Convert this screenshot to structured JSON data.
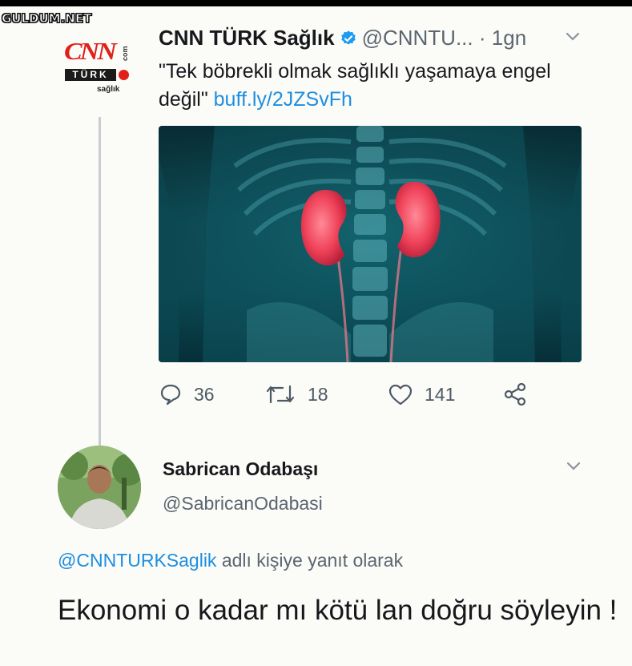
{
  "watermark": "GULDUM.NET",
  "colors": {
    "link": "#1d8ee0",
    "brand_red": "#e0201b",
    "secondary_text": "#5b6670",
    "media_teal": "#0d4852",
    "kidney": "#f0435a"
  },
  "original_tweet": {
    "avatar_logo": {
      "word": "CNN",
      "sub_bar": "TÜRK",
      "side": "com",
      "caption": "sağlık"
    },
    "display_name": "CNN TÜRK Sağlık",
    "verified_icon": "verified-badge-icon",
    "handle": "@CNNTU...",
    "separator": "·",
    "time": "1gn",
    "menu_icon": "chevron-down-icon",
    "text": "\"Tek böbrekli olmak sağlıklı yaşamaya engel değil\"",
    "link": "buff.ly/2JZSvFh",
    "media_icon": "kidney-anatomy-illustration",
    "actions": {
      "reply": {
        "icon": "reply-icon",
        "count": "36"
      },
      "retweet": {
        "icon": "retweet-icon",
        "count": "18"
      },
      "like": {
        "icon": "heart-icon",
        "count": "141"
      },
      "share": {
        "icon": "share-icon"
      }
    }
  },
  "reply_tweet": {
    "avatar_icon": "user-avatar-photo",
    "display_name": "Sabrican Odabaşı",
    "handle": "@SabricanOdabasi",
    "menu_icon": "chevron-down-icon",
    "reply_to_mention": "@CNNTURKSaglik",
    "reply_to_suffix": " adlı kişiye yanıt olarak",
    "text": "Ekonomi o kadar mı kötü lan doğru söyleyin !"
  }
}
